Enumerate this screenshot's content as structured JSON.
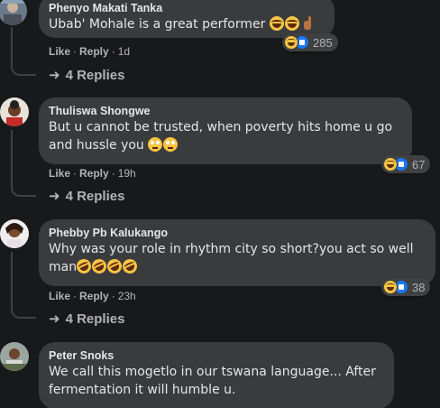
{
  "comments": [
    {
      "author": "Phenyo Makati Tanka",
      "text": "Ubab' Mohale is a great performer",
      "emojis": [
        "laugh",
        "laugh",
        "hand"
      ],
      "like_label": "Like",
      "reply_label": "Reply",
      "time": "1d",
      "reaction_count": "285",
      "replies_label": "4 Replies"
    },
    {
      "author": "Thuliswa Shongwe",
      "text_line1": "But u cannot be trusted, when poverty hits home u go",
      "text_line2": "and hussle you",
      "emojis": [
        "roll",
        "roll"
      ],
      "like_label": "Like",
      "reply_label": "Reply",
      "time": "19h",
      "reaction_count": "67",
      "replies_label": "4 Replies"
    },
    {
      "author": "Phebby Pb Kalukango",
      "text_line1": "Why was your role in rhythm city so short?you act so well",
      "text_line2": "man",
      "emojis": [
        "rofl",
        "rofl",
        "rofl",
        "rofl"
      ],
      "like_label": "Like",
      "reply_label": "Reply",
      "time": "23h",
      "reaction_count": "38",
      "replies_label": "4 Replies"
    },
    {
      "author": "Peter Snoks",
      "text_line1": "We call this mogetlo in our tswana language... After",
      "text_line2": "fermentation it will humble u."
    }
  ],
  "separator": "·",
  "colors": {
    "background": "#18191a",
    "bubble": "#3a3b3c",
    "text": "#e4e6eb",
    "secondary": "#b0b3b8",
    "like_blue": "#1877f2",
    "haha_yellow": "#f7c544"
  }
}
